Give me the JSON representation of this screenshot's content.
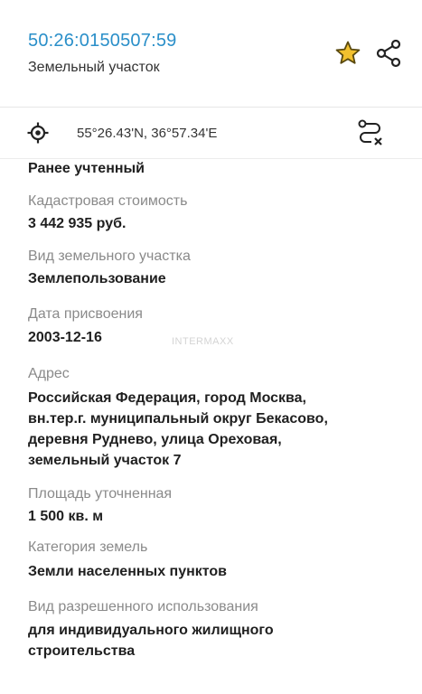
{
  "header": {
    "cadastral_number": "50:26:0150507:59",
    "object_type": "Земельный участок"
  },
  "coords": {
    "text": "55°26.43'N, 36°57.34'E"
  },
  "fields": {
    "status_value": "Ранее учтенный",
    "cadastral_value_label": "Кадастровая стоимость",
    "cadastral_value": "3 442 935 руб.",
    "land_type_label": "Вид земельного участка",
    "land_type": "Землепользование",
    "assign_date_label": "Дата присвоения",
    "assign_date": "2003-12-16",
    "address_label": "Адрес",
    "address_lines": [
      "Российская Федерация, город Москва,",
      "вн.тер.г. муниципальный округ Бекасово,",
      "деревня Руднево, улица Ореховая,",
      "земельный участок 7"
    ],
    "area_label": "Площадь уточненная",
    "area": "1 500 кв. м",
    "category_label": "Категория земель",
    "category": "Земли населенных пунктов",
    "usage_label": "Вид разрешенного использования",
    "usage_lines": [
      "для индивидуального жилищного",
      "строительства"
    ]
  },
  "watermark": "INTERMAXX",
  "colors": {
    "accent": "#2a8fc9",
    "star_fill": "#f2c12e",
    "label": "#8a8a8a",
    "value": "#1f1f1f"
  },
  "icons": {
    "favorite": "star-icon",
    "share": "share-icon",
    "location": "target-icon",
    "route": "route-icon"
  }
}
